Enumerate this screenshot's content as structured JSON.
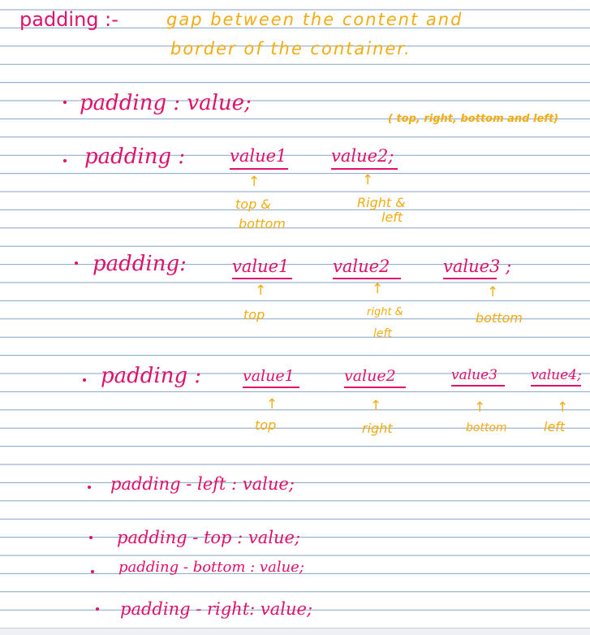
{
  "colors": {
    "pink_ink": "#e0116a",
    "yellow_ink": "#f2ac10",
    "rule_line": "#5b86b8"
  },
  "definition": {
    "term": "padding :-",
    "line1": "gap between the content and",
    "line2": "border of the container."
  },
  "syntax_1": {
    "code": "padding : value;",
    "note": "( top, right, bottom and left)"
  },
  "syntax_2": {
    "prop": "padding :",
    "v1": "value1",
    "v2": "value2;",
    "label_v1": [
      "top &",
      "bottom"
    ],
    "label_v2": [
      "Right &",
      "left"
    ]
  },
  "syntax_3": {
    "prop": "padding:",
    "v1": "value1",
    "v2": "value2",
    "v3": "value3 ;",
    "label_v1": "top",
    "label_v2": [
      "right &",
      "left"
    ],
    "label_v3": "bottom"
  },
  "syntax_4": {
    "prop": "padding :",
    "v1": "value1",
    "v2": "value2",
    "v3": "value3",
    "v4": "value4;",
    "label_v1": "top",
    "label_v2": "right",
    "label_v3": "bottom",
    "label_v4": "left"
  },
  "longhand": {
    "left": "padding - left : value;",
    "top": "padding - top : value;",
    "bottom": "padding - bottom : value;",
    "right": "padding - right: value;"
  }
}
